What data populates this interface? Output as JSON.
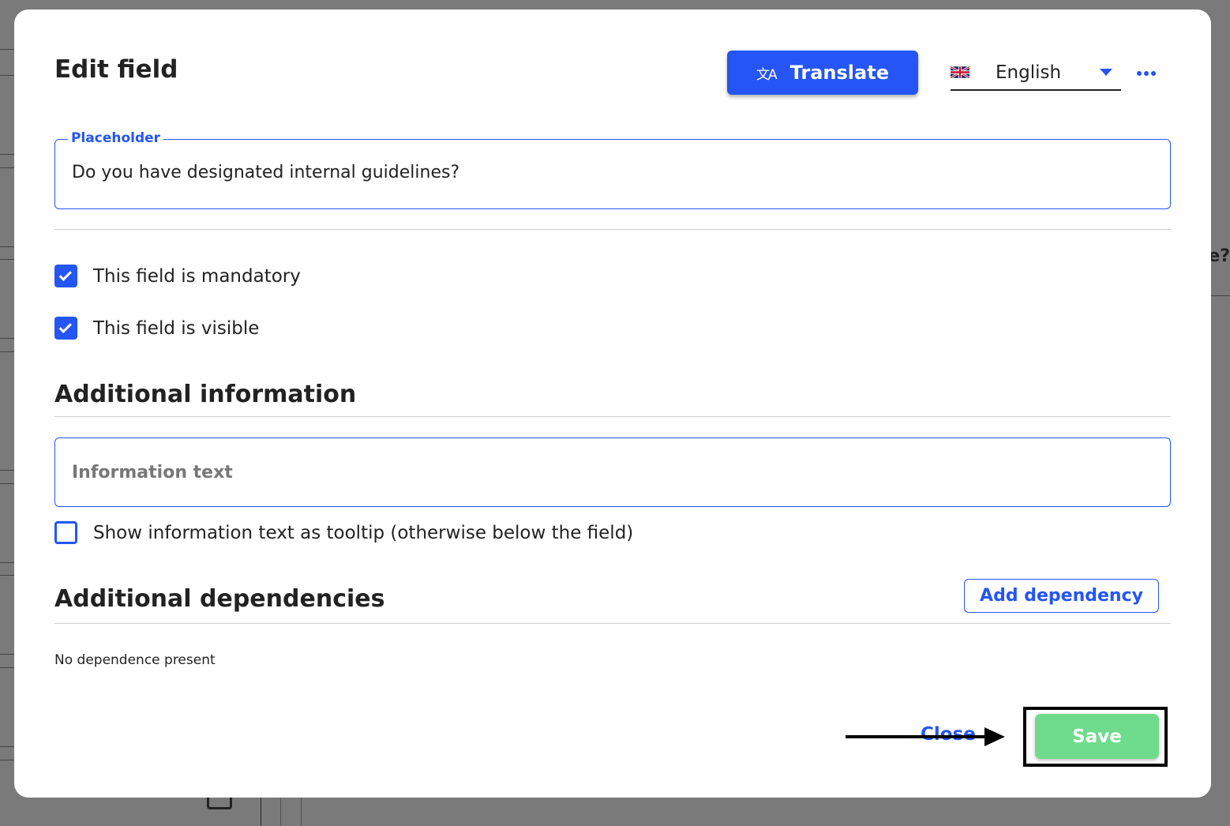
{
  "background": {
    "partial_text": "ne?"
  },
  "dialog": {
    "title": "Edit field",
    "translate_button": {
      "label": "Translate",
      "icon": "translate-icon"
    },
    "language_select": {
      "value": "English",
      "flag": "uk-flag-icon"
    },
    "more_menu_icon": "more-horizontal-icon",
    "placeholder_field": {
      "legend": "Placeholder",
      "value": "Do you have designated internal guidelines?"
    },
    "checkboxes": [
      {
        "label": "This field is mandatory",
        "checked": true
      },
      {
        "label": "This field is visible",
        "checked": true
      }
    ],
    "additional_information": {
      "title": "Additional information",
      "input_placeholder": "Information text",
      "input_value": "",
      "tooltip_checkbox": {
        "label": "Show information text as tooltip (otherwise below the field)",
        "checked": false
      }
    },
    "additional_dependencies": {
      "title": "Additional dependencies",
      "add_button": "Add dependency",
      "empty_text": "No dependence present"
    },
    "footer": {
      "close_label": "Close",
      "save_label": "Save"
    }
  },
  "colors": {
    "accent": "#2555f5",
    "save": "#6edc8c",
    "overlay": "#7a7a7a"
  }
}
